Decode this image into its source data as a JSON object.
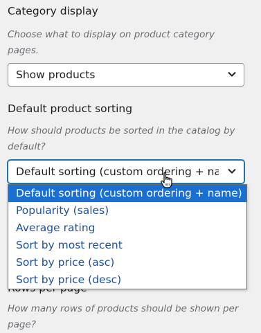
{
  "category_display": {
    "title": "Category display",
    "description": "Choose what to display on product category pages.",
    "selected": "Show products"
  },
  "default_sorting": {
    "title": "Default product sorting",
    "description": "How should products be sorted in the catalog by default?",
    "selected": "Default sorting (custom ordering + name)",
    "options": [
      "Default sorting (custom ordering + name)",
      "Popularity (sales)",
      "Average rating",
      "Sort by most recent",
      "Sort by price (asc)",
      "Sort by price (desc)"
    ],
    "selected_index": 0
  },
  "rows_per_page": {
    "title": "Rows per page",
    "description": "How many rows of products should be shown per page?"
  },
  "colors": {
    "accent": "#2271b1",
    "highlight": "#1a6fd1",
    "background": "#f0f0f1"
  }
}
